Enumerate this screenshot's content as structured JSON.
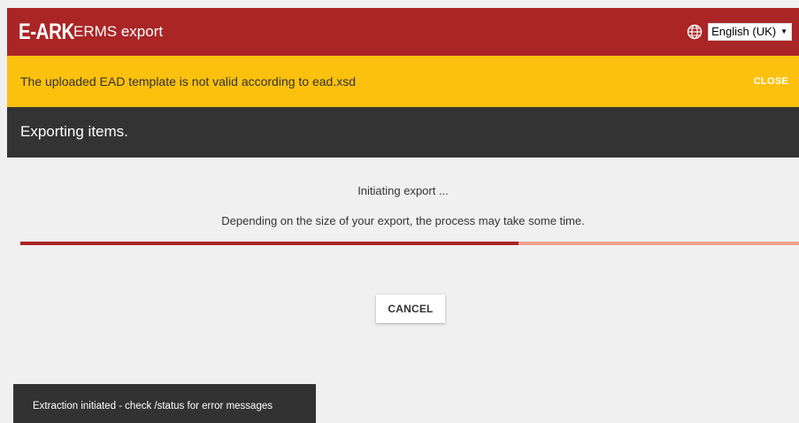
{
  "header": {
    "logo_text": "E-ARK",
    "app_name": "ERMS export",
    "language": {
      "icon": "globe-icon",
      "selected": "English (UK)"
    }
  },
  "warning": {
    "message": "The uploaded EAD template is not valid according to ead.xsd",
    "close_label": "CLOSE"
  },
  "section": {
    "title": "Exporting items."
  },
  "main": {
    "status": "Initiating export ...",
    "info": "Depending on the size of your export, the process may take some time.",
    "progress": 0.64,
    "cancel_label": "CANCEL"
  },
  "toast": {
    "message": "Extraction initiated - check /status for error messages"
  },
  "colors": {
    "brand_red": "#aa2525",
    "warning_yellow": "#fcc10e",
    "dark_bar": "#333333",
    "progress_track": "#f0a090",
    "background": "#f0f0f0"
  }
}
